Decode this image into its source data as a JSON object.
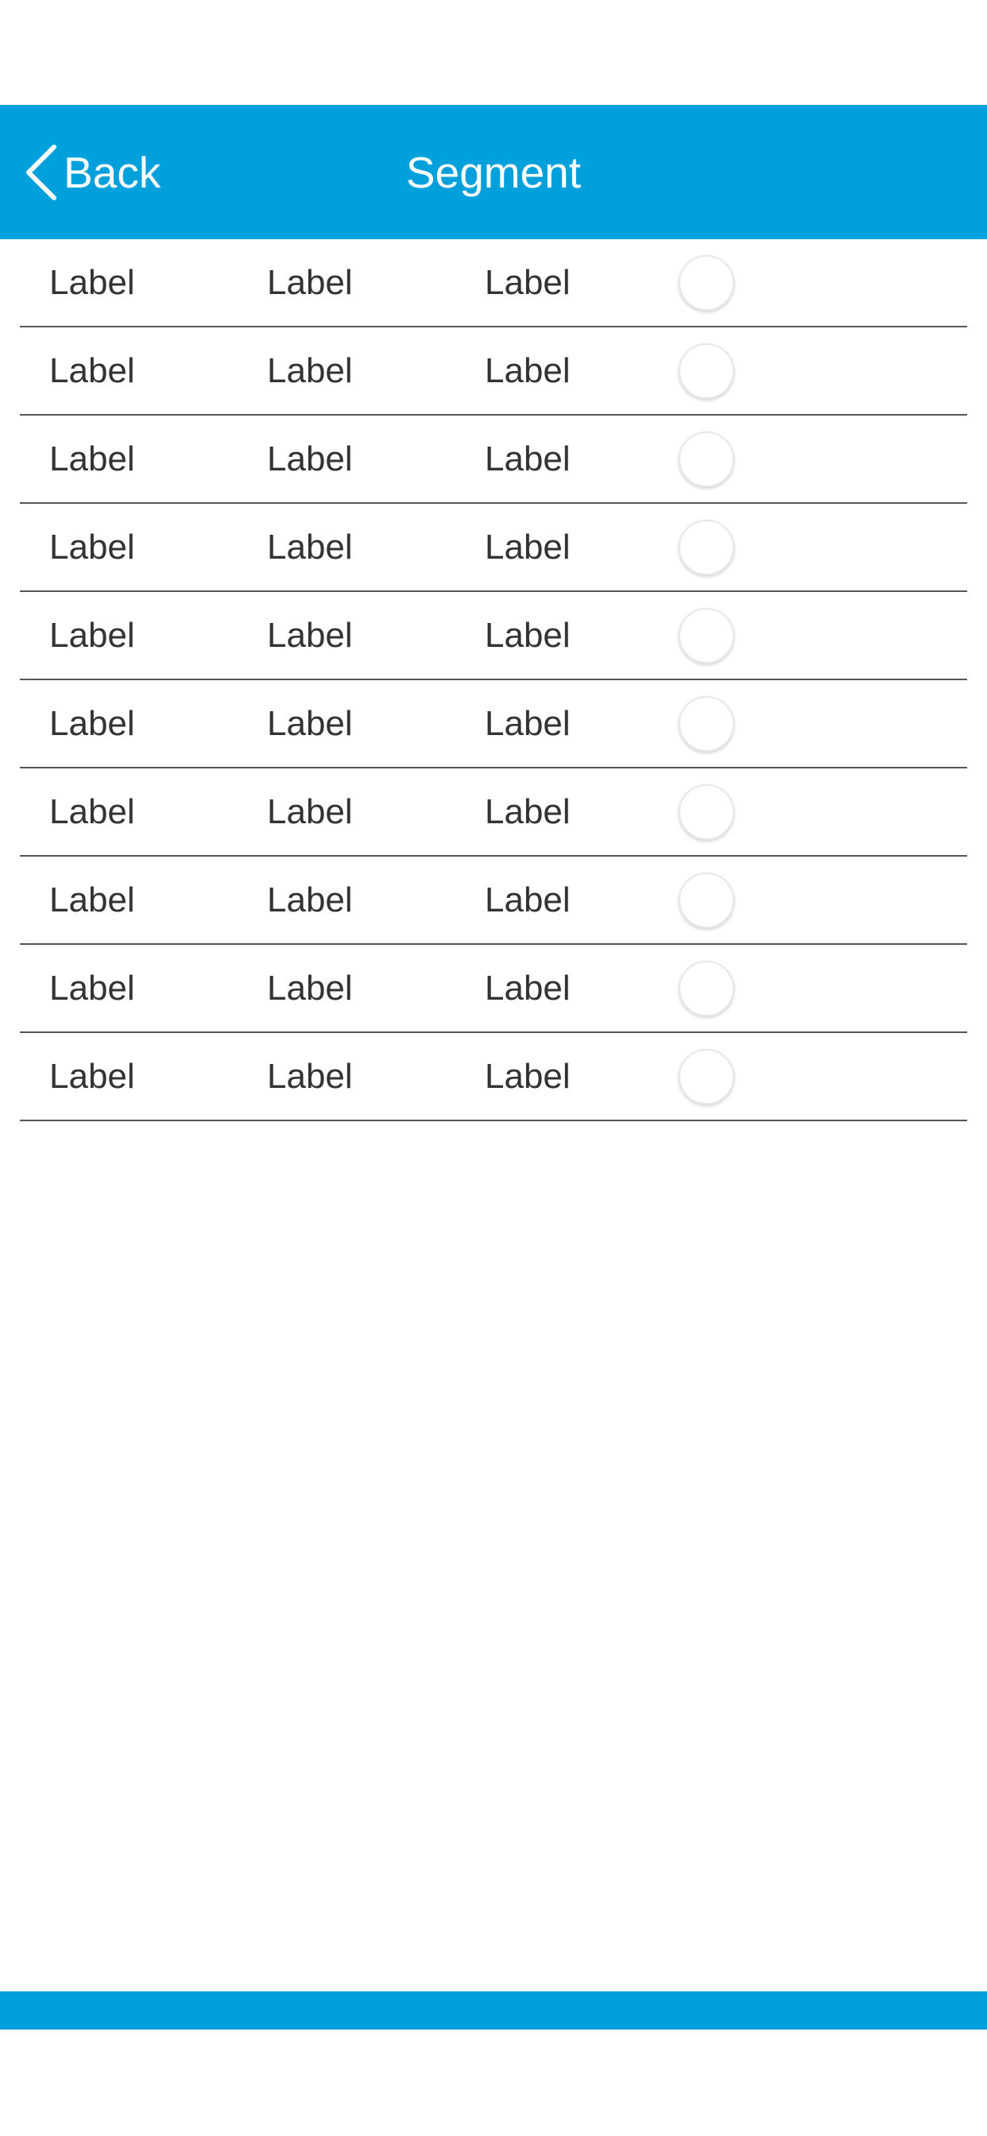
{
  "colors": {
    "accent": "#00a0dc",
    "text": "#333333",
    "divider": "#555555",
    "background": "#ffffff"
  },
  "nav": {
    "back_label": "Back",
    "back_icon": "chevron-left-icon",
    "title": "Segment"
  },
  "list": {
    "rows": [
      {
        "col1": "Label",
        "col2": "Label",
        "col3": "Label",
        "selected": false
      },
      {
        "col1": "Label",
        "col2": "Label",
        "col3": "Label",
        "selected": false
      },
      {
        "col1": "Label",
        "col2": "Label",
        "col3": "Label",
        "selected": false
      },
      {
        "col1": "Label",
        "col2": "Label",
        "col3": "Label",
        "selected": false
      },
      {
        "col1": "Label",
        "col2": "Label",
        "col3": "Label",
        "selected": false
      },
      {
        "col1": "Label",
        "col2": "Label",
        "col3": "Label",
        "selected": false
      },
      {
        "col1": "Label",
        "col2": "Label",
        "col3": "Label",
        "selected": false
      },
      {
        "col1": "Label",
        "col2": "Label",
        "col3": "Label",
        "selected": false
      },
      {
        "col1": "Label",
        "col2": "Label",
        "col3": "Label",
        "selected": false
      },
      {
        "col1": "Label",
        "col2": "Label",
        "col3": "Label",
        "selected": false
      }
    ]
  }
}
